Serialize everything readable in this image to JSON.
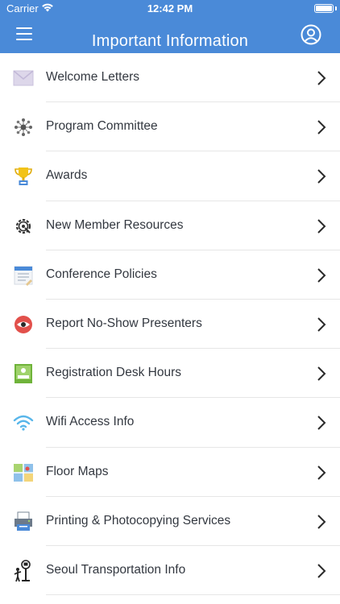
{
  "status_bar": {
    "carrier": "Carrier",
    "time": "12:42 PM"
  },
  "header": {
    "title": "Important Information",
    "background": "#4a8ad8"
  },
  "items": [
    {
      "label": "Welcome Letters",
      "icon": "envelope-icon"
    },
    {
      "label": "Program Committee",
      "icon": "network-icon"
    },
    {
      "label": "Awards",
      "icon": "trophy-icon"
    },
    {
      "label": "New Member Resources",
      "icon": "gear-icon"
    },
    {
      "label": "Conference Policies",
      "icon": "document-icon"
    },
    {
      "label": "Report No-Show Presenters",
      "icon": "eye-icon"
    },
    {
      "label": "Registration Desk Hours",
      "icon": "desk-icon"
    },
    {
      "label": "Wifi Access Info",
      "icon": "wifi-icon"
    },
    {
      "label": "Floor Maps",
      "icon": "map-icon"
    },
    {
      "label": "Printing & Photocopying Services",
      "icon": "printer-icon"
    },
    {
      "label": "Seoul Transportation Info",
      "icon": "bus-stop-icon"
    }
  ]
}
